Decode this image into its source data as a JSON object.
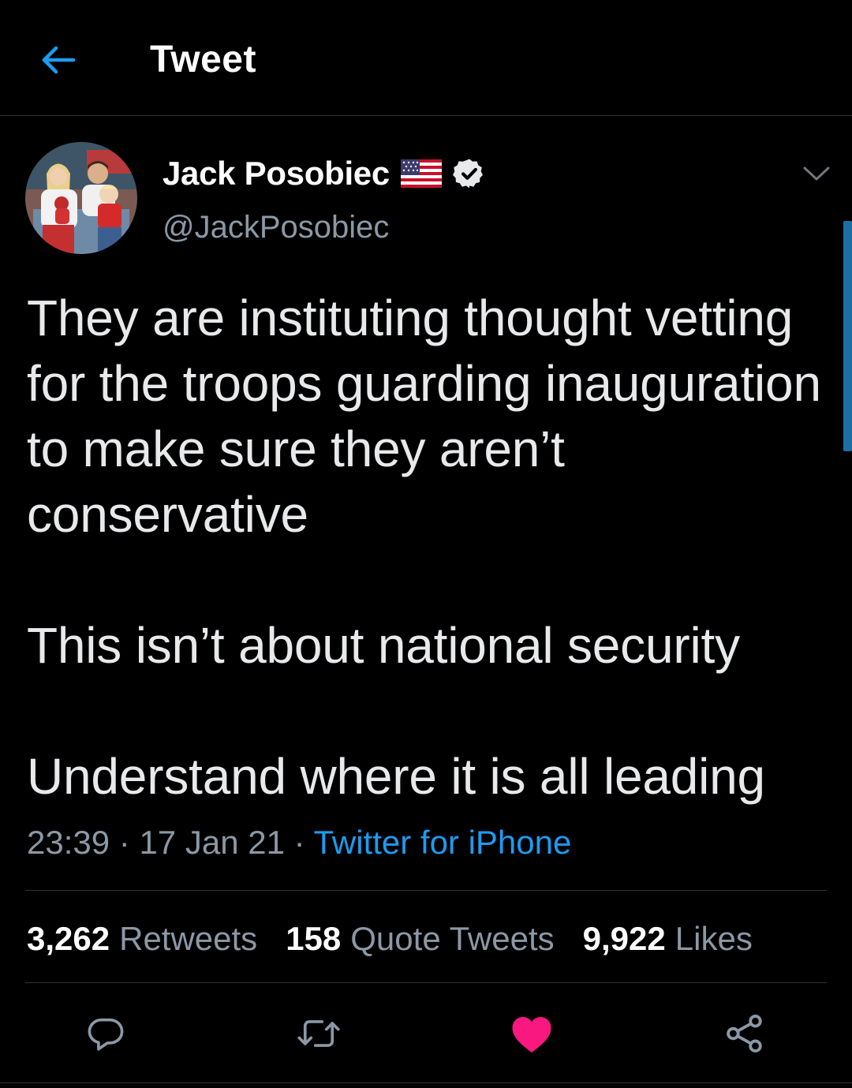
{
  "header": {
    "title": "Tweet",
    "back_icon": "arrow-left-icon"
  },
  "author": {
    "name": "Jack Posobiec",
    "flag_icon": "us-flag-icon",
    "verified_icon": "verified-badge-icon",
    "handle": "@JackPosobiec"
  },
  "tweet": {
    "paragraphs": [
      "They are instituting thought vetting for the troops guarding inauguration to make sure they aren’t conservative",
      "This isn’t about national security",
      "Understand where it is all leading"
    ],
    "time": "23:39",
    "separator": "·",
    "date": "17 Jan 21",
    "source": "Twitter for iPhone"
  },
  "stats": {
    "retweets_count": "3,262",
    "retweets_label": "Retweets",
    "quotes_count": "158",
    "quotes_label": "Quote Tweets",
    "likes_count": "9,922",
    "likes_label": "Likes"
  },
  "colors": {
    "background": "#000000",
    "accent": "#1d9bf0",
    "like": "#f91880",
    "muted": "#8b98a5"
  }
}
